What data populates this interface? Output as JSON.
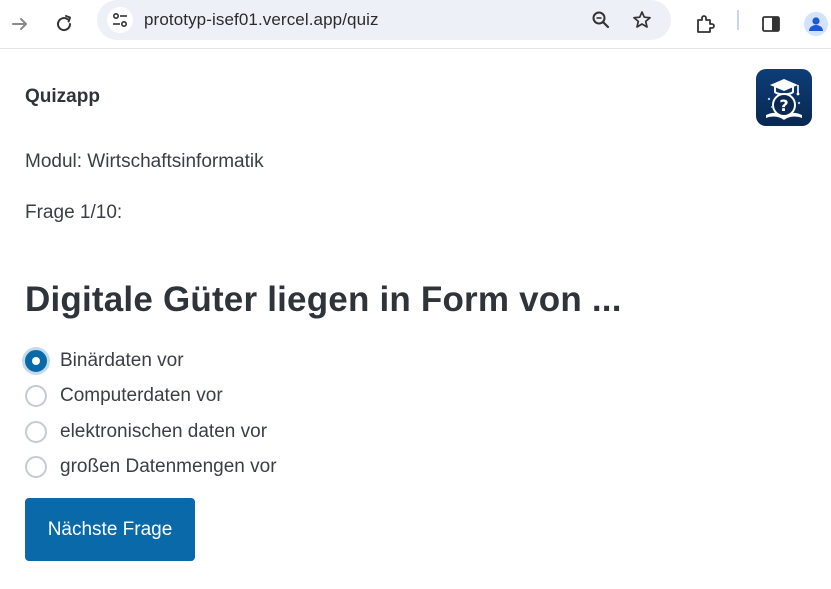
{
  "browser": {
    "url": "prototyp-isef01.vercel.app/quiz",
    "icons": [
      "forward-icon",
      "reload-icon",
      "site-info-icon",
      "zoom-icon",
      "bookmark-star-icon",
      "extensions-icon",
      "side-panel-icon",
      "profile-icon"
    ]
  },
  "app": {
    "title": "Quizapp",
    "logo_icon": "quiz-logo-icon"
  },
  "quiz": {
    "modul": "Modul: Wirtschaftsinformatik",
    "progress": "Frage 1/10:",
    "question": "Digitale Güter liegen in Form von ...",
    "options": [
      {
        "label": "Binärdaten vor",
        "selected": true
      },
      {
        "label": "Computerdaten vor",
        "selected": false
      },
      {
        "label": "elektronischen daten vor",
        "selected": false
      },
      {
        "label": "großen Datenmengen vor",
        "selected": false
      }
    ],
    "next_label": "Nächste Frage"
  },
  "colors": {
    "accent": "#0a6aa9",
    "logo_bg": "#0d3d78",
    "text": "#333a40"
  }
}
